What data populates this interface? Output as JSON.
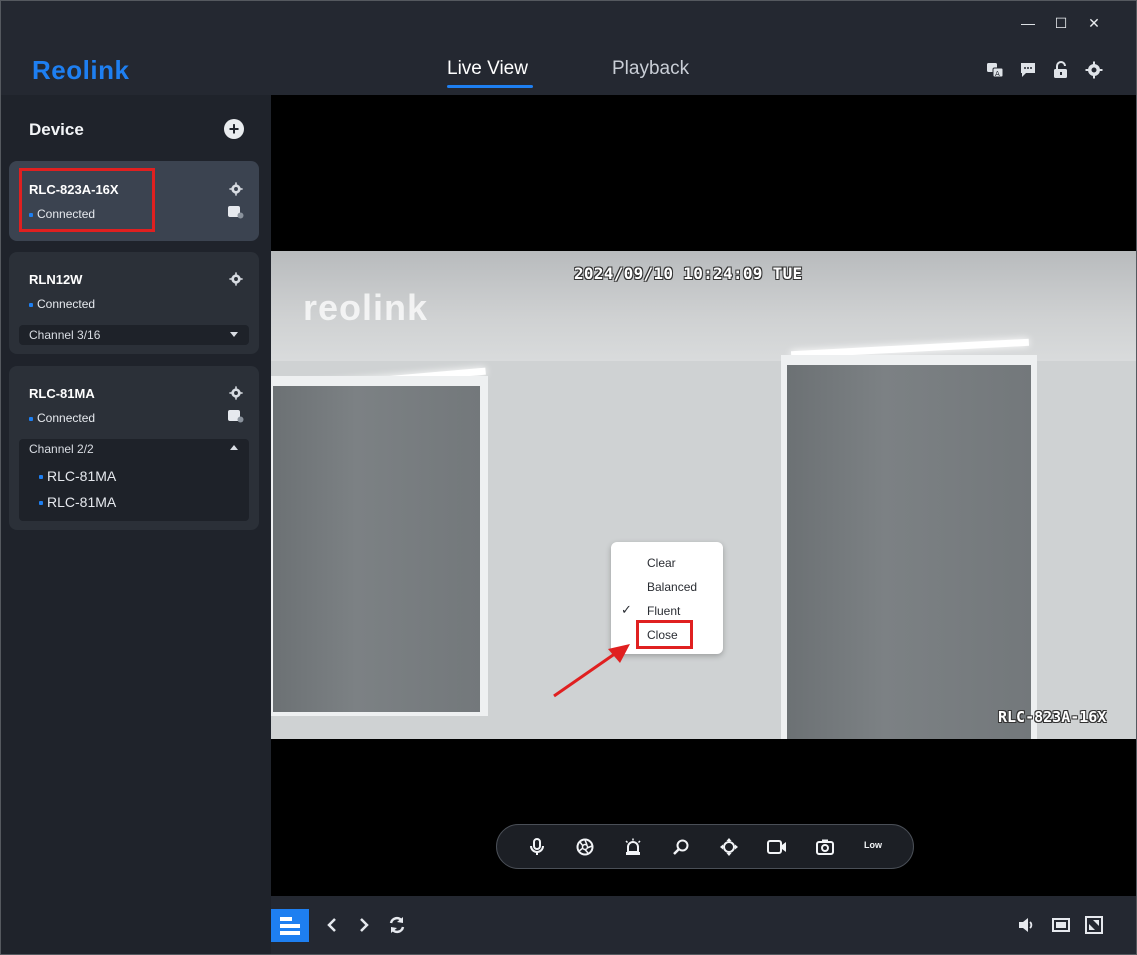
{
  "app": {
    "brand": "Reolink",
    "window_controls": {
      "minimize": "—",
      "maximize": "☐",
      "close": "✕"
    }
  },
  "header": {
    "tabs": [
      {
        "label": "Live View",
        "active": true
      },
      {
        "label": "Playback",
        "active": false
      }
    ],
    "icons": [
      "translate-icon",
      "message-icon",
      "unlock-icon",
      "gear-icon"
    ]
  },
  "sidebar": {
    "title": "Device",
    "add_icon": "+",
    "devices": [
      {
        "name": "RLC-823A-16X",
        "status": "Connected",
        "selected": true
      },
      {
        "name": "RLN12W",
        "status": "Connected",
        "channel": "Channel 3/16"
      },
      {
        "name": "RLC-81MA",
        "status": "Connected",
        "channel": "Channel 2/2",
        "channels": [
          "RLC-81MA",
          "RLC-81MA"
        ]
      }
    ]
  },
  "video": {
    "osd_time": "2024/09/10 10:24:09 TUE",
    "osd_logo": "reolink",
    "osd_camera": "RLC-823A-16X"
  },
  "context_menu": {
    "items": [
      {
        "label": "Clear",
        "checked": false
      },
      {
        "label": "Balanced",
        "checked": false
      },
      {
        "label": "Fluent",
        "checked": true
      },
      {
        "label": "Close",
        "checked": false
      }
    ],
    "check_mark": "✓"
  },
  "toolbar": {
    "icons": [
      "microphone-icon",
      "aperture-icon",
      "siren-icon",
      "zoom-icon",
      "ptz-icon",
      "record-icon",
      "snapshot-icon"
    ],
    "quality_label": "Low"
  },
  "bottombar": {
    "icons": [
      "layout-icon",
      "prev-icon",
      "next-icon",
      "refresh-icon",
      "volume-icon",
      "window-icon",
      "fullscreen-icon"
    ]
  },
  "colors": {
    "accent": "#1e7ff1",
    "highlight": "#e02020",
    "background": "#1f232b"
  }
}
